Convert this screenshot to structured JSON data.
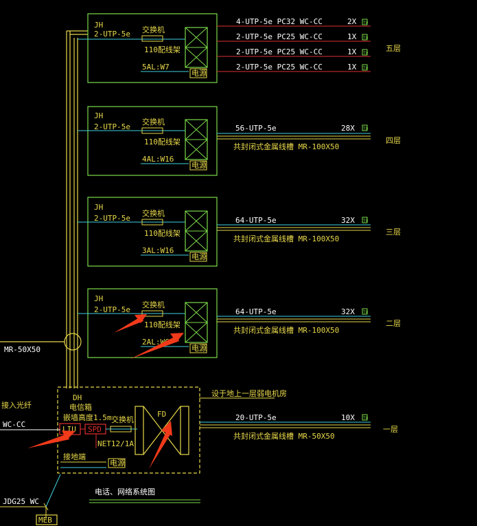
{
  "title": "电话、网络系统图",
  "floors": [
    {
      "name": "五层",
      "jh": "JH",
      "riser": "2-UTP-5e",
      "switch": "交换机",
      "patch": "110配线架",
      "power_circuit": "5AL:W7",
      "power": "电源",
      "outlets": [
        {
          "cable": "4-UTP-5e PC32 WC-CC",
          "count": "2X"
        },
        {
          "cable": "2-UTP-5e PC25 WC-CC",
          "count": "1X"
        },
        {
          "cable": "2-UTP-5e PC25 WC-CC",
          "count": "1X"
        },
        {
          "cable": "2-UTP-5e PC25 WC-CC",
          "count": "1X"
        }
      ]
    },
    {
      "name": "四层",
      "jh": "JH",
      "riser": "2-UTP-5e",
      "switch": "交换机",
      "patch": "110配线架",
      "power_circuit": "4AL:W16",
      "power": "电源",
      "cable": "56-UTP-5e",
      "count": "28X",
      "tray": "共封闭式金属线槽 MR-100X50"
    },
    {
      "name": "三层",
      "jh": "JH",
      "riser": "2-UTP-5e",
      "switch": "交换机",
      "patch": "110配线架",
      "power_circuit": "3AL:W16",
      "power": "电源",
      "cable": "64-UTP-5e",
      "count": "32X",
      "tray": "共封闭式金属线槽 MR-100X50"
    },
    {
      "name": "二层",
      "jh": "JH",
      "riser": "2-UTP-5e",
      "switch": "交换机",
      "patch": "110配线架",
      "power_circuit": "2AL:W6",
      "power": "电源",
      "cable": "64-UTP-5e",
      "count": "32X",
      "tray": "共封闭式金属线槽 MR-100X50"
    }
  ],
  "ground_floor": {
    "name": "一层",
    "dh": "DH",
    "cabinet": "电信箱",
    "mount": "嵌墙高度1.5m",
    "liu": "LIU",
    "spd": "SPD",
    "switch": "交换机",
    "spd_model": "NET12/1A",
    "fd": "FD",
    "ground": "接地端",
    "power": "电源",
    "location_note": "设于地上一层弱电机房",
    "cable": "20-UTP-5e",
    "count": "10X",
    "tray": "共封闭式金属线槽 MR-50X50"
  },
  "left": {
    "riser_tray": "MR-50X50",
    "incoming": "接入光纤",
    "wc": "WC-CC",
    "conduit": "JDG25 WC",
    "mfb": "MEB"
  },
  "colors": {
    "cabinet_green": "#7ddc4a",
    "text_yellow": "#e8d84a",
    "red_line": "#e03030",
    "cyan_line": "#3fd0e0",
    "arrow_red": "#f03a1a"
  }
}
